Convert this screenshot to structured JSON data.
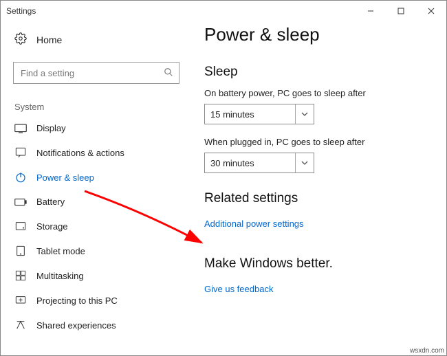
{
  "window": {
    "title": "Settings"
  },
  "sidebar": {
    "home_label": "Home",
    "search_placeholder": "Find a setting",
    "section_label": "System",
    "items": [
      {
        "label": "Display"
      },
      {
        "label": "Notifications & actions"
      },
      {
        "label": "Power & sleep"
      },
      {
        "label": "Battery"
      },
      {
        "label": "Storage"
      },
      {
        "label": "Tablet mode"
      },
      {
        "label": "Multitasking"
      },
      {
        "label": "Projecting to this PC"
      },
      {
        "label": "Shared experiences"
      }
    ]
  },
  "main": {
    "title": "Power & sleep",
    "sleep": {
      "heading": "Sleep",
      "battery_label": "On battery power, PC goes to sleep after",
      "battery_value": "15 minutes",
      "plugged_label": "When plugged in, PC goes to sleep after",
      "plugged_value": "30 minutes"
    },
    "related": {
      "heading": "Related settings",
      "link": "Additional power settings"
    },
    "feedback": {
      "heading": "Make Windows better.",
      "link": "Give us feedback"
    }
  },
  "watermark": "wsxdn.com"
}
